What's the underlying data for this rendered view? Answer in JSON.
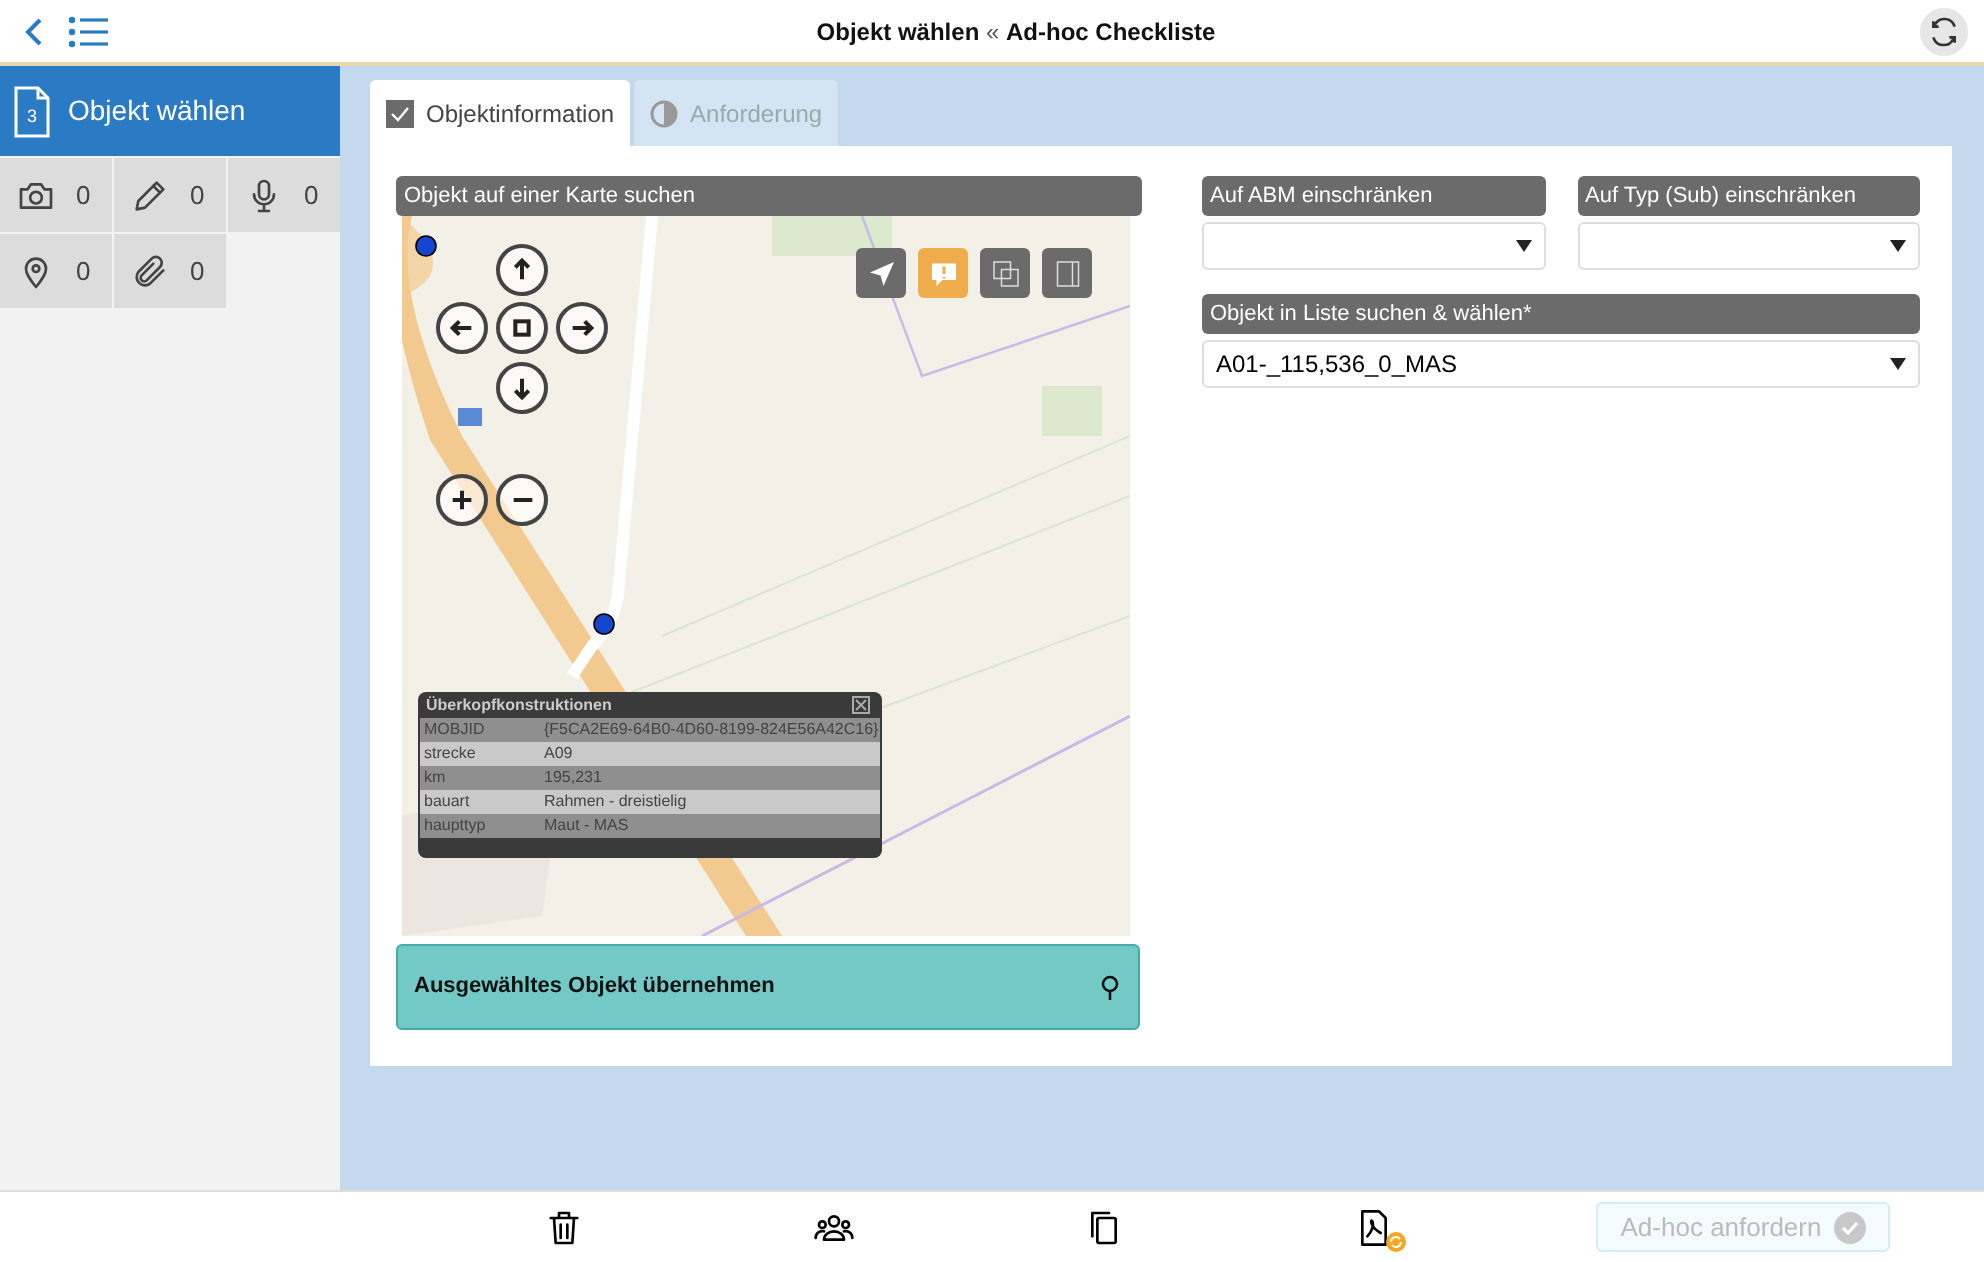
{
  "header": {
    "title": "**Objekt wählen** « **Ad-hoc Checkliste**"
  },
  "sidebar": {
    "step": {
      "number": "3",
      "label": "Objekt wählen",
      "selected": true
    },
    "counters": [
      {
        "kind": "camera",
        "count": "0"
      },
      {
        "kind": "pencil",
        "count": "0"
      },
      {
        "kind": "microphone",
        "count": "0"
      },
      {
        "kind": "pin",
        "count": "0"
      },
      {
        "kind": "paperclip",
        "count": "0"
      }
    ]
  },
  "tabs": [
    {
      "label": "Objektinformation",
      "selected": true,
      "kind": "complete"
    },
    {
      "label": "Anforderung",
      "selected": false,
      "kind": "partial"
    }
  ],
  "map_section": {
    "label": "Objekt auf einer Karte suchen",
    "tools": [
      {
        "kind": "locate",
        "active": false
      },
      {
        "kind": "info",
        "active": true
      },
      {
        "kind": "layers",
        "active": false
      },
      {
        "kind": "film",
        "active": false
      }
    ],
    "popup": {
      "title": "Überkopfkonstruktionen",
      "rows": [
        {
          "key": "MOBJID",
          "value": "{F5CA2E69-64B0-4D60-8199-824E56A42C16}"
        },
        {
          "key": "strecke",
          "value": "A09"
        },
        {
          "key": "km",
          "value": "195,231"
        },
        {
          "key": "bauart",
          "value": "Rahmen - dreistielig"
        },
        {
          "key": "haupttyp",
          "value": "Maut - MAS"
        }
      ]
    },
    "apply_button": "Ausgewähltes Objekt übernehmen"
  },
  "filters": [
    {
      "label": "Auf ABM einschränken"
    },
    {
      "label": "Auf Typ (Sub) einschränken"
    }
  ],
  "object_select": {
    "label": "Objekt in Liste suchen & wählen*",
    "value": "A01-_115,536_0_MAS"
  },
  "footer": {
    "actions": [
      {
        "kind": "trash"
      },
      {
        "kind": "people"
      },
      {
        "kind": "copy"
      },
      {
        "kind": "pdf"
      }
    ],
    "request_button": {
      "label": "Ad-hoc anfordern",
      "disabled": true
    }
  }
}
